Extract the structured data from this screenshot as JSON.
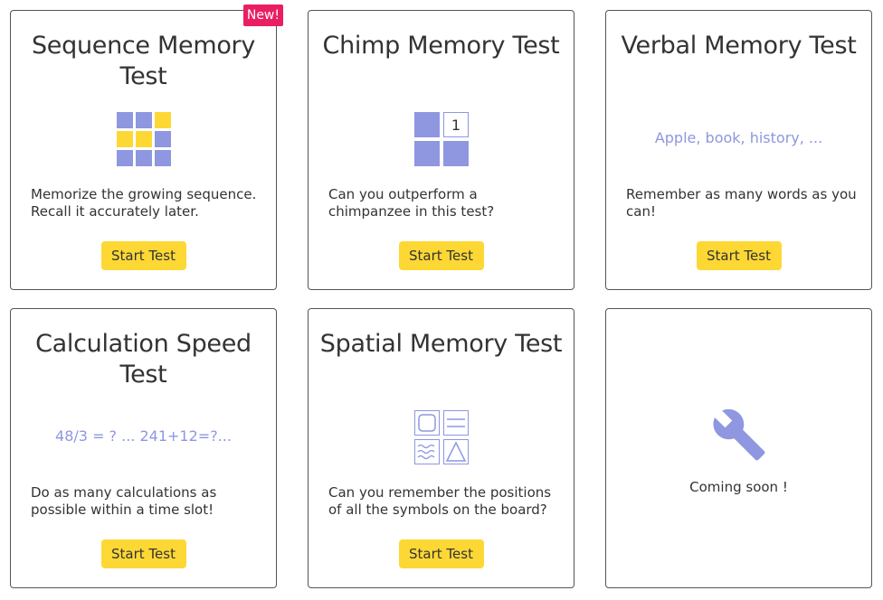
{
  "colors": {
    "accent": "#8e97e0",
    "highlight": "#fdd835",
    "badge": "#e91e63",
    "text": "#333333"
  },
  "cards": [
    {
      "title": "Sequence Memory Test",
      "badge": "New!",
      "icon": "sequence-grid-icon",
      "description": "Memorize the growing sequence. Recall it accurately later.",
      "button": "Start Test"
    },
    {
      "title": "Chimp Memory Test",
      "icon": "chimp-grid-icon",
      "icon_number": "1",
      "description": "Can you outperform a chimpanzee in this test?",
      "button": "Start Test"
    },
    {
      "title": "Verbal Memory Test",
      "sample": "Apple, book, history, ...",
      "description": "Remember as many words as you can!",
      "button": "Start Test"
    },
    {
      "title": "Calculation Speed Test",
      "sample": "48/3 = ? ... 241+12=?...",
      "description": "Do as many calculations as possible within a time slot!",
      "button": "Start Test"
    },
    {
      "title": "Spatial Memory Test",
      "icon": "spatial-symbols-icon",
      "description": "Can you remember the positions of all the symbols on the board?",
      "button": "Start Test"
    },
    {
      "icon": "wrench-icon",
      "coming": "Coming soon !"
    }
  ]
}
